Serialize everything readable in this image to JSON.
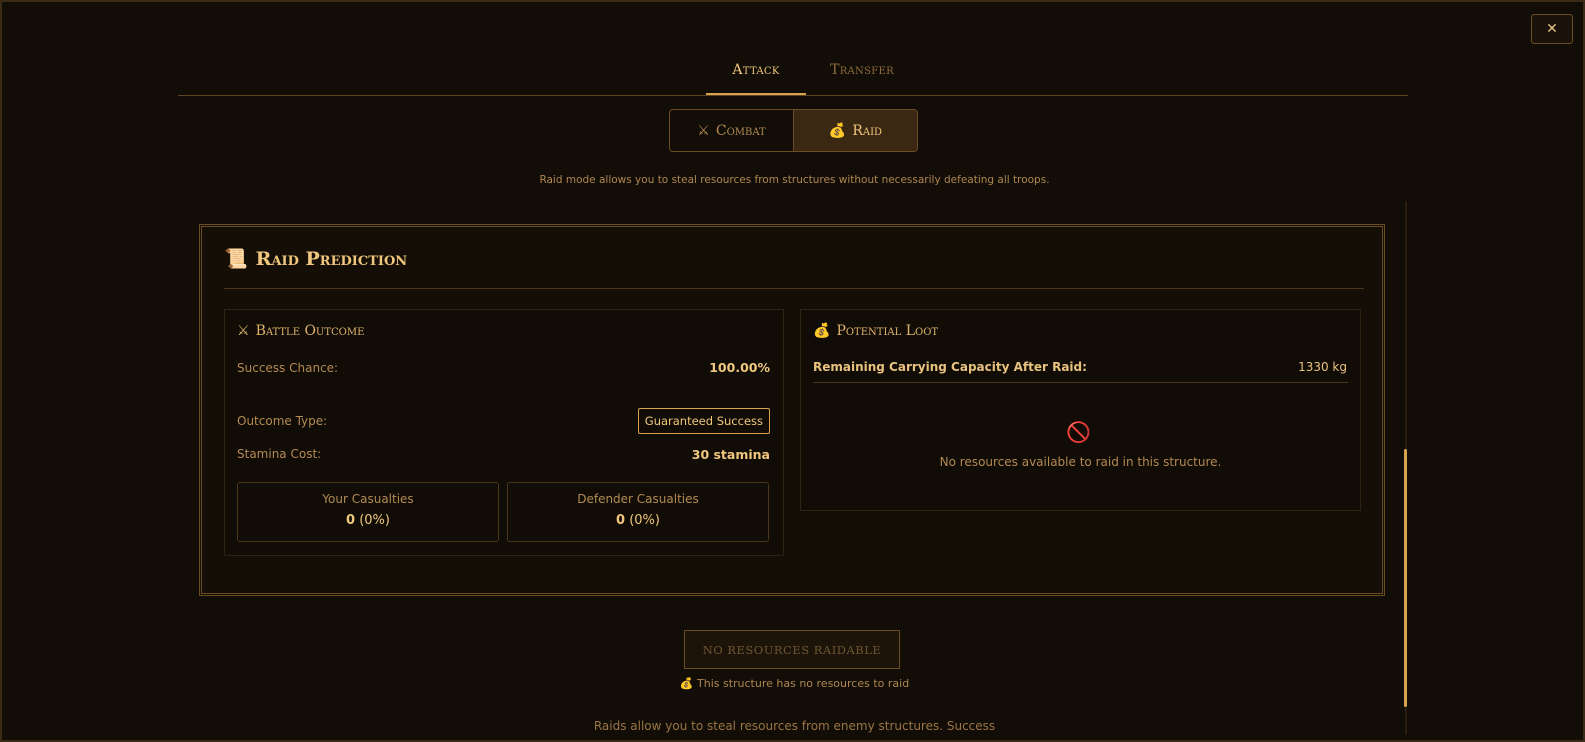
{
  "close_label": "✕",
  "tabs": [
    {
      "label": "Attack",
      "active": true
    },
    {
      "label": "Transfer",
      "active": false
    }
  ],
  "modes": {
    "combat_label": "Combat",
    "combat_icon": "⚔",
    "raid_label": "Raid",
    "raid_icon": "💰",
    "selected": "raid"
  },
  "mode_description": "Raid mode allows you to steal resources from structures without necessarily defeating all troops.",
  "prediction": {
    "icon": "📜",
    "title": "Raid Prediction",
    "battle": {
      "icon": "⚔",
      "title": "Battle Outcome",
      "success_label": "Success Chance:",
      "success_value": "100.00%",
      "outcome_label": "Outcome Type:",
      "outcome_value": "Guaranteed Success",
      "stamina_label": "Stamina Cost:",
      "stamina_value": "30 stamina",
      "your_casualties_label": "Your Casualties",
      "your_casualties_count": "0",
      "your_casualties_pct": "(0%)",
      "defender_casualties_label": "Defender Casualties",
      "defender_casualties_count": "0",
      "defender_casualties_pct": "(0%)"
    },
    "loot": {
      "icon": "💰",
      "title": "Potential Loot",
      "capacity_label": "Remaining Carrying Capacity After Raid:",
      "capacity_value": "1330 kg",
      "empty_icon": "🚫",
      "empty_text": "No resources available to raid in this structure."
    }
  },
  "action_button": "NO RESOURCES RAIDABLE",
  "raid_note_icon": "💰",
  "raid_note": "This structure has no resources to raid",
  "footer": "Raids allow you to steal resources from enemy structures. Success",
  "colors": {
    "accent": "#d8a24e",
    "text": "#f0c77c",
    "background": "#120d06"
  }
}
